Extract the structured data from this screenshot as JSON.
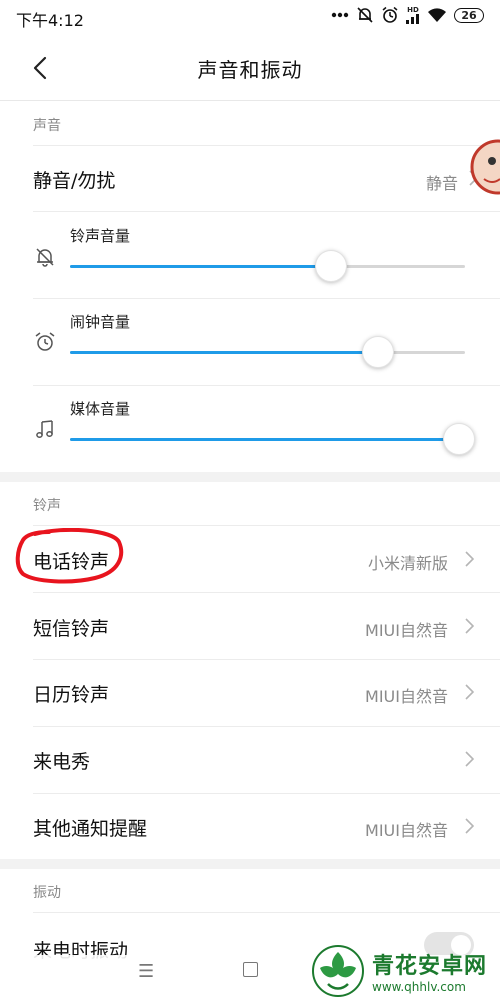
{
  "status_bar": {
    "time": "下午4:12",
    "signal_label": "HD",
    "battery": "26",
    "icons": [
      "more-dots-icon",
      "mute-bell-icon",
      "alarm-icon",
      "hd-signal-icon",
      "wifi-icon",
      "battery-icon"
    ]
  },
  "header": {
    "title": "声音和振动",
    "back_icon": "back-arrow-icon"
  },
  "sections": {
    "sound": "声音",
    "ringtone": "铃声",
    "vibration": "振动"
  },
  "silent_row": {
    "label": "静音/勿扰",
    "value": "静音"
  },
  "volumes": [
    {
      "label": "铃声音量",
      "icon": "bell-off-icon",
      "level": 0.66
    },
    {
      "label": "闹钟音量",
      "icon": "alarm-clock-icon",
      "level": 0.78
    },
    {
      "label": "媒体音量",
      "icon": "music-note-icon",
      "level": 1.0
    }
  ],
  "ringtone_rows": [
    {
      "label": "电话铃声",
      "value": "小米清新版"
    },
    {
      "label": "短信铃声",
      "value": "MIUI自然音"
    },
    {
      "label": "日历铃声",
      "value": "MIUI自然音"
    },
    {
      "label": "来电秀",
      "value": ""
    },
    {
      "label": "其他通知提醒",
      "value": "MIUI自然音"
    }
  ],
  "vibration_row": {
    "label": "来电时振动",
    "toggle_on": false
  },
  "watermark": {
    "name": "青花安卓网",
    "url": "www.qhhlv.com"
  },
  "colors": {
    "accent": "#1f9be8",
    "annotation": "#e8141e",
    "watermark": "#1c7a2e"
  }
}
